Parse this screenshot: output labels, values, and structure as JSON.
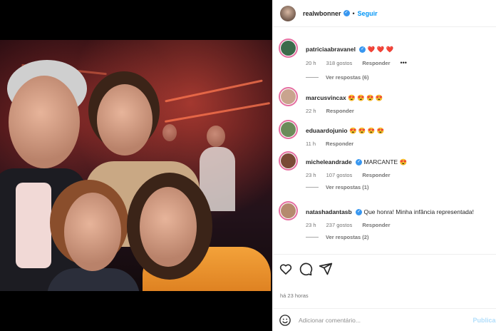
{
  "header": {
    "username": "realwbonner",
    "separator": "•",
    "follow_label": "Seguir"
  },
  "comments": [
    {
      "user": "patriciaabravanel",
      "verified": true,
      "text": "❤️ ❤️ ❤️",
      "time": "20 h",
      "likes": "318 gostos",
      "reply": "Responder",
      "more": "•••",
      "replies": "Ver respostas (6)"
    },
    {
      "user": "marcusvincax",
      "verified": false,
      "text": "😍 😍 😍 😍",
      "time": "22 h",
      "likes": "",
      "reply": "Responder"
    },
    {
      "user": "eduaardojunio",
      "verified": false,
      "text": "😍 😍 😍 😍",
      "time": "11 h",
      "likes": "",
      "reply": "Responder"
    },
    {
      "user": "micheleandrade",
      "verified": true,
      "text": "MARCANTE 😍",
      "time": "23 h",
      "likes": "107 gostos",
      "reply": "Responder",
      "replies": "Ver respostas (1)"
    },
    {
      "user": "natashadantasb",
      "verified": true,
      "text": "Que honra! Minha infância representada!",
      "time": "23 h",
      "likes": "237 gostos",
      "reply": "Responder",
      "replies": "Ver respostas (2)"
    }
  ],
  "actions": {
    "like_icon": "heart-icon",
    "comment_icon": "comment-icon",
    "share_icon": "share-icon"
  },
  "post_time": "há 23 horas",
  "add_comment": {
    "placeholder": "Adicionar comentário...",
    "post_label": "Publicar"
  },
  "colors": {
    "link_blue": "#0095f6",
    "verified_blue": "#3897f0",
    "muted": "#737373"
  }
}
